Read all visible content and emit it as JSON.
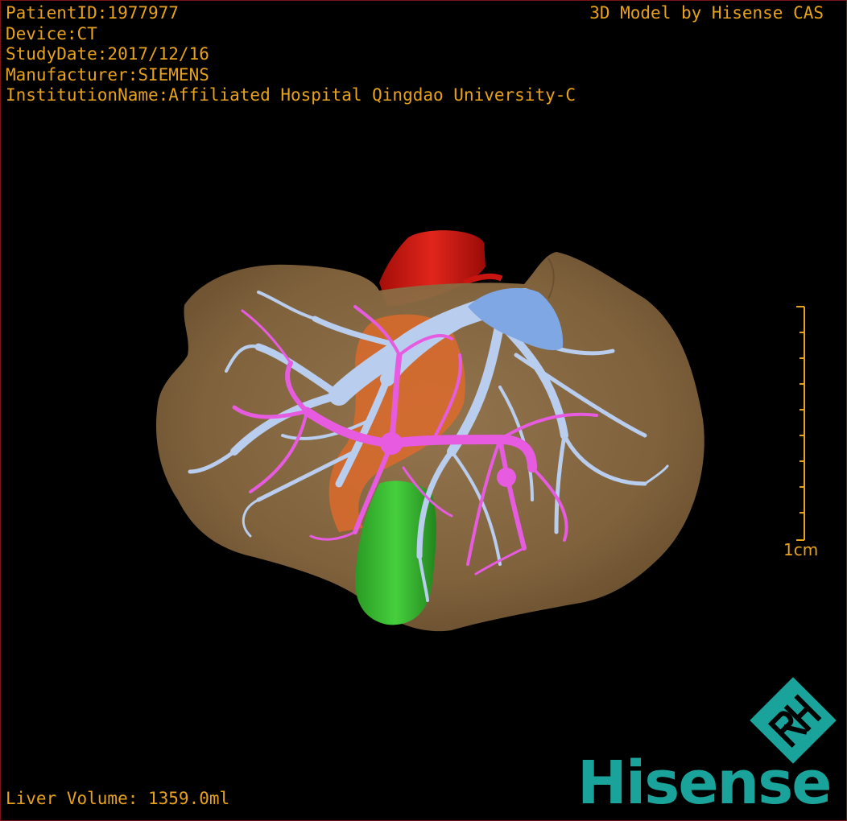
{
  "overlay": {
    "patient_id": "PatientID:1977977",
    "device": "Device:CT",
    "study_date": "StudyDate:2017/12/16",
    "manufacturer": "Manufacturer:SIEMENS",
    "institution": "InstitutionName:Affiliated Hospital Qingdao University-C",
    "credit": "3D Model by Hisense CAS",
    "liver_volume": "Liver Volume: 1359.0ml"
  },
  "scale": {
    "label": "1cm"
  },
  "logo": {
    "wordmark": "Hisense",
    "emblem_text": "RH"
  },
  "colors": {
    "overlay_text": "#e8a21a",
    "liver": "#8c6c45",
    "portal_vein": "#b9cdef",
    "hepatic_vessels": "#e65be0",
    "aorta": "#c8150f",
    "ivc": "#e16a2a",
    "gallbladder": "#2fb52a",
    "hepatic_vein_confluence": "#7ea7e3",
    "brand": "#1aa39a"
  }
}
